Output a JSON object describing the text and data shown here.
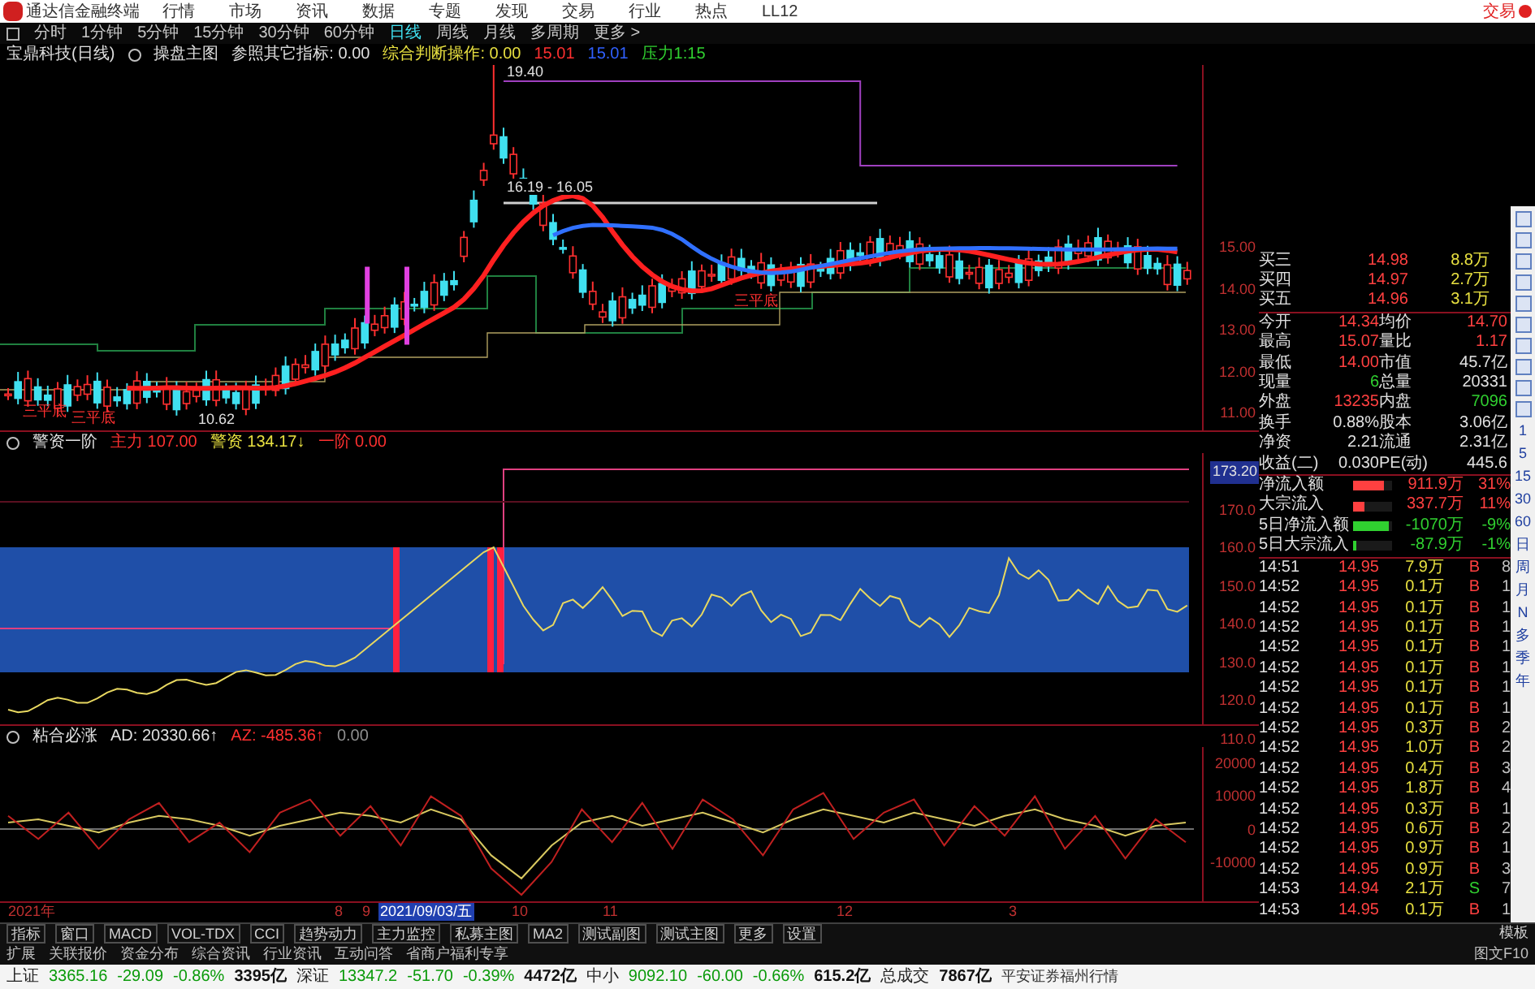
{
  "title_bar": {
    "app_name": "通达信金融终端",
    "menu": [
      "行情",
      "市场",
      "资讯",
      "数据",
      "专题",
      "发现",
      "交易",
      "行业",
      "热点",
      "LL12"
    ],
    "trade_button": "交易"
  },
  "period_bar": {
    "items": [
      {
        "label": "分时",
        "selected": false
      },
      {
        "label": "1分钟",
        "selected": false
      },
      {
        "label": "5分钟",
        "selected": false
      },
      {
        "label": "15分钟",
        "selected": false
      },
      {
        "label": "30分钟",
        "selected": false
      },
      {
        "label": "60分钟",
        "selected": false
      },
      {
        "label": "日线",
        "selected": true
      },
      {
        "label": "周线",
        "selected": false
      },
      {
        "label": "月线",
        "selected": false
      },
      {
        "label": "多周期",
        "selected": false
      },
      {
        "label": "更多 >",
        "selected": false
      }
    ]
  },
  "main_chart": {
    "title": "宝鼎科技(日线)",
    "indicator": "操盘主图",
    "legend": [
      {
        "text": "参照其它指标: 0.00",
        "color": "#e0e0e0"
      },
      {
        "text": "综合判断操作: 0.00",
        "color": "#e8e040"
      },
      {
        "text": "15.01",
        "color": "#ff3030"
      },
      {
        "text": "15.01",
        "color": "#3060ff"
      },
      {
        "text": "压力1:15",
        "color": "#30d030"
      }
    ],
    "annotations": [
      {
        "text": "19.40",
        "kind": "price"
      },
      {
        "text": "16.19 - 16.05",
        "kind": "price"
      },
      {
        "text": "10.62",
        "kind": "price"
      },
      {
        "text": "三平底",
        "kind": "signal"
      },
      {
        "text": "三平底",
        "kind": "signal"
      },
      {
        "text": "三平底",
        "kind": "signal"
      }
    ],
    "axis": [
      "15.00",
      "14.00",
      "13.00",
      "12.00",
      "11.00"
    ]
  },
  "sub_chart_1": {
    "indicator": "警资一阶",
    "legend": [
      {
        "text": "主力 107.00",
        "color": "#ff3030"
      },
      {
        "text": "警资 134.17↓",
        "color": "#e8e040"
      },
      {
        "text": "一阶 0.00",
        "color": "#ff3030"
      }
    ],
    "axis_marker": "173.20",
    "axis": [
      "170.0",
      "160.0",
      "150.0",
      "140.0",
      "130.0",
      "120.0",
      "110.0"
    ]
  },
  "sub_chart_2": {
    "indicator": "粘合必涨",
    "legend": [
      {
        "text": "AD: 20330.66↑",
        "color": "#e0e0e0"
      },
      {
        "text": "AZ: -485.36↑",
        "color": "#ff3030"
      },
      {
        "text": "0.00",
        "color": "#909090"
      }
    ],
    "chart_data": {
      "type": "line",
      "ylim": [
        -22000,
        25000
      ],
      "yticks": [
        20000,
        10000,
        0,
        -10000
      ],
      "series": [
        {
          "color": "#d8c860",
          "values": [
            2000,
            3000,
            1000,
            -1000,
            2000,
            4000,
            3000,
            1000,
            -2000,
            1000,
            3000,
            5000,
            4000,
            2000,
            6000,
            3000,
            -8000,
            -15000,
            -5000,
            2000,
            4000,
            1000,
            3000,
            5000,
            2000,
            -1000,
            3000,
            6000,
            4000,
            2000,
            5000,
            3000,
            1000,
            4000,
            6000,
            3000,
            1000,
            -2000,
            1000,
            2000
          ]
        },
        {
          "color": "#c02020",
          "values": [
            4000,
            -3000,
            5000,
            -6000,
            3000,
            8000,
            -4000,
            2000,
            -7000,
            5000,
            9000,
            -2000,
            7000,
            -5000,
            10000,
            4000,
            -12000,
            -20000,
            -10000,
            6000,
            -4000,
            8000,
            -6000,
            9000,
            3000,
            -8000,
            6000,
            11000,
            -3000,
            5000,
            9000,
            -5000,
            7000,
            -2000,
            10000,
            -6000,
            4000,
            -9000,
            3000,
            -4000
          ]
        }
      ]
    }
  },
  "date_axis": [
    {
      "text": "2021年",
      "selected": false
    },
    {
      "text": "8",
      "selected": false
    },
    {
      "text": "9",
      "selected": false
    },
    {
      "text": "2021/09/03/五",
      "selected": true
    },
    {
      "text": "10",
      "selected": false
    },
    {
      "text": "11",
      "selected": false
    },
    {
      "text": "12",
      "selected": false
    },
    {
      "text": "3",
      "selected": false
    }
  ],
  "quote_panel": {
    "order_book": [
      {
        "label": "买三",
        "price": "14.98",
        "volume": "8.8万"
      },
      {
        "label": "买四",
        "price": "14.97",
        "volume": "2.7万"
      },
      {
        "label": "买五",
        "price": "14.96",
        "volume": "3.1万"
      }
    ],
    "stats": [
      {
        "cells": [
          {
            "label": "今开",
            "value": "14.34",
            "color": "#ff4040"
          },
          {
            "label": "均价",
            "value": "14.70",
            "color": "#ff4040"
          }
        ]
      },
      {
        "cells": [
          {
            "label": "最高",
            "value": "15.07",
            "color": "#ff4040"
          },
          {
            "label": "量比",
            "value": "1.17",
            "color": "#ff4040"
          }
        ]
      },
      {
        "cells": [
          {
            "label": "最低",
            "value": "14.00",
            "color": "#ff4040"
          },
          {
            "label": "市值",
            "value": "45.7亿",
            "color": "#e0e0e0"
          }
        ]
      },
      {
        "cells": [
          {
            "label": "现量",
            "value": "6",
            "color": "#30d030"
          },
          {
            "label": "总量",
            "value": "20331",
            "color": "#e0e0e0"
          }
        ]
      },
      {
        "cells": [
          {
            "label": "外盘",
            "value": "13235",
            "color": "#ff4040"
          },
          {
            "label": "内盘",
            "value": "7096",
            "color": "#30d030"
          }
        ]
      },
      {
        "cells": [
          {
            "label": "换手",
            "value": "0.88%",
            "color": "#e0e0e0"
          },
          {
            "label": "股本",
            "value": "3.06亿",
            "color": "#e0e0e0"
          }
        ]
      },
      {
        "cells": [
          {
            "label": "净资",
            "value": "2.21",
            "color": "#e0e0e0"
          },
          {
            "label": "流通",
            "value": "2.31亿",
            "color": "#e0e0e0"
          }
        ]
      },
      {
        "cells": [
          {
            "label": "收益(二)",
            "value": "0.030",
            "color": "#e0e0e0"
          },
          {
            "label": "PE(动)",
            "value": "445.6",
            "color": "#e0e0e0"
          }
        ]
      }
    ],
    "flows": [
      {
        "label": "净流入额",
        "level": 0.8,
        "color": "#ff4040",
        "amount": "911.9万",
        "percent": "31%"
      },
      {
        "label": "大宗流入",
        "level": 0.3,
        "color": "#ff4040",
        "amount": "337.7万",
        "percent": "11%"
      },
      {
        "label": "5日净流入额",
        "level": 0.9,
        "color": "#30d030",
        "amount": "-1070万",
        "percent": "-9%"
      },
      {
        "label": "5日大宗流入",
        "level": 0.1,
        "color": "#30d030",
        "amount": "-87.9万",
        "percent": "-1%"
      }
    ],
    "ticks": [
      {
        "time": "14:51",
        "price": "14.95",
        "volume": "7.9万",
        "side": "B",
        "count": "8"
      },
      {
        "time": "14:52",
        "price": "14.95",
        "volume": "0.1万",
        "side": "B",
        "count": "1"
      },
      {
        "time": "14:52",
        "price": "14.95",
        "volume": "0.1万",
        "side": "B",
        "count": "1"
      },
      {
        "time": "14:52",
        "price": "14.95",
        "volume": "0.1万",
        "side": "B",
        "count": "1"
      },
      {
        "time": "14:52",
        "price": "14.95",
        "volume": "0.1万",
        "side": "B",
        "count": "1"
      },
      {
        "time": "14:52",
        "price": "14.95",
        "volume": "0.1万",
        "side": "B",
        "count": "1"
      },
      {
        "time": "14:52",
        "price": "14.95",
        "volume": "0.1万",
        "side": "B",
        "count": "1"
      },
      {
        "time": "14:52",
        "price": "14.95",
        "volume": "0.1万",
        "side": "B",
        "count": "1"
      },
      {
        "time": "14:52",
        "price": "14.95",
        "volume": "0.3万",
        "side": "B",
        "count": "2"
      },
      {
        "time": "14:52",
        "price": "14.95",
        "volume": "1.0万",
        "side": "B",
        "count": "2"
      },
      {
        "time": "14:52",
        "price": "14.95",
        "volume": "0.4万",
        "side": "B",
        "count": "3"
      },
      {
        "time": "14:52",
        "price": "14.95",
        "volume": "1.8万",
        "side": "B",
        "count": "4"
      },
      {
        "time": "14:52",
        "price": "14.95",
        "volume": "0.3万",
        "side": "B",
        "count": "1"
      },
      {
        "time": "14:52",
        "price": "14.95",
        "volume": "0.6万",
        "side": "B",
        "count": "2"
      },
      {
        "time": "14:52",
        "price": "14.95",
        "volume": "0.9万",
        "side": "B",
        "count": "1"
      },
      {
        "time": "14:52",
        "price": "14.95",
        "volume": "0.9万",
        "side": "B",
        "count": "3"
      },
      {
        "time": "14:53",
        "price": "14.94",
        "volume": "2.1万",
        "side": "S",
        "count": "7"
      },
      {
        "time": "14:53",
        "price": "14.95",
        "volume": "0.1万",
        "side": "B",
        "count": "1"
      }
    ]
  },
  "side_toolbar": {
    "periods": [
      "1",
      "5",
      "15",
      "30",
      "60",
      "日",
      "周",
      "月",
      "N",
      "多",
      "季",
      "年"
    ]
  },
  "indicator_tabs": {
    "items": [
      "指标",
      "窗口",
      "MACD",
      "VOL-TDX",
      "CCI",
      "趋势动力",
      "主力监控",
      "私募主图",
      "MA2",
      "测试副图",
      "测试主图",
      "更多",
      "设置"
    ],
    "right": "模板"
  },
  "info_tabs": {
    "items": [
      "扩展",
      "关联报价",
      "资金分布",
      "综合资讯",
      "行业资讯",
      "互动问答",
      "省商户福利专享"
    ],
    "right": "图文F10"
  },
  "status_bar": [
    {
      "text": "上证",
      "kind": "label"
    },
    {
      "text": "3365.16",
      "kind": "down"
    },
    {
      "text": "-29.09",
      "kind": "down"
    },
    {
      "text": "-0.86%",
      "kind": "down"
    },
    {
      "text": "3395亿",
      "kind": "amount"
    },
    {
      "text": "深证",
      "kind": "label"
    },
    {
      "text": "13347.2",
      "kind": "down"
    },
    {
      "text": "-51.70",
      "kind": "down"
    },
    {
      "text": "-0.39%",
      "kind": "down"
    },
    {
      "text": "4472亿",
      "kind": "amount"
    },
    {
      "text": "中小",
      "kind": "label"
    },
    {
      "text": "9092.10",
      "kind": "down"
    },
    {
      "text": "-60.00",
      "kind": "down"
    },
    {
      "text": "-0.66%",
      "kind": "down"
    },
    {
      "text": "615.2亿",
      "kind": "amount"
    },
    {
      "text": "总成交",
      "kind": "label"
    },
    {
      "text": "7867亿",
      "kind": "amount"
    },
    {
      "text": "平安证券福州行情",
      "kind": "info"
    }
  ]
}
